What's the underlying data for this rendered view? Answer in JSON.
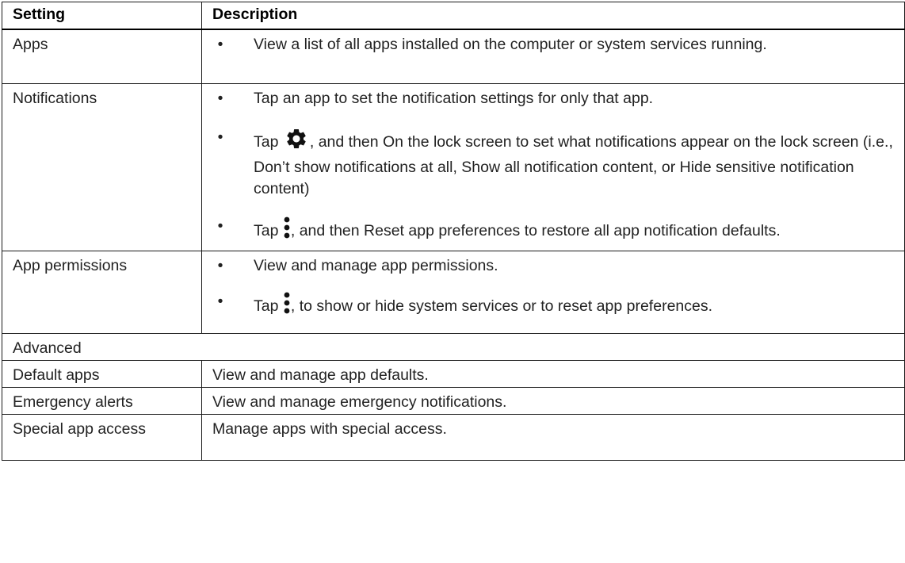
{
  "table": {
    "header": {
      "setting": "Setting",
      "description": "Description"
    },
    "rows": {
      "apps": {
        "setting": "Apps",
        "bullet1": "View a list of all apps installed on the computer or system services running."
      },
      "notifications": {
        "setting": "Notifications",
        "bullet1": "Tap an app to set the notification settings for only that app.",
        "bullet2_prefix": "Tap ",
        "bullet2_suffix": ", and then On the lock screen to set what notifications appear on the lock screen (i.e., Don’t show notifications at all, Show all notification content, or Hide sensitive notification content)",
        "bullet3_prefix": "Tap ",
        "bullet3_suffix": ", and then Reset app preferences to restore all app notification defaults."
      },
      "app_permissions": {
        "setting": "App permissions",
        "bullet1": "View and manage app permissions.",
        "bullet2_prefix": "Tap ",
        "bullet2_suffix": ", to show or hide system services or to reset app preferences."
      },
      "advanced": {
        "label": "Advanced"
      },
      "default_apps": {
        "setting": "Default apps",
        "description": "View and manage app defaults."
      },
      "emergency_alerts": {
        "setting": "Emergency alerts",
        "description": "View and manage emergency notifications."
      },
      "special_app_access": {
        "setting": "Special app access",
        "description": "Manage apps with special access."
      }
    },
    "bullet_char": "•",
    "icons": {
      "gear": "gear-icon",
      "more": "more-vert-icon"
    }
  }
}
